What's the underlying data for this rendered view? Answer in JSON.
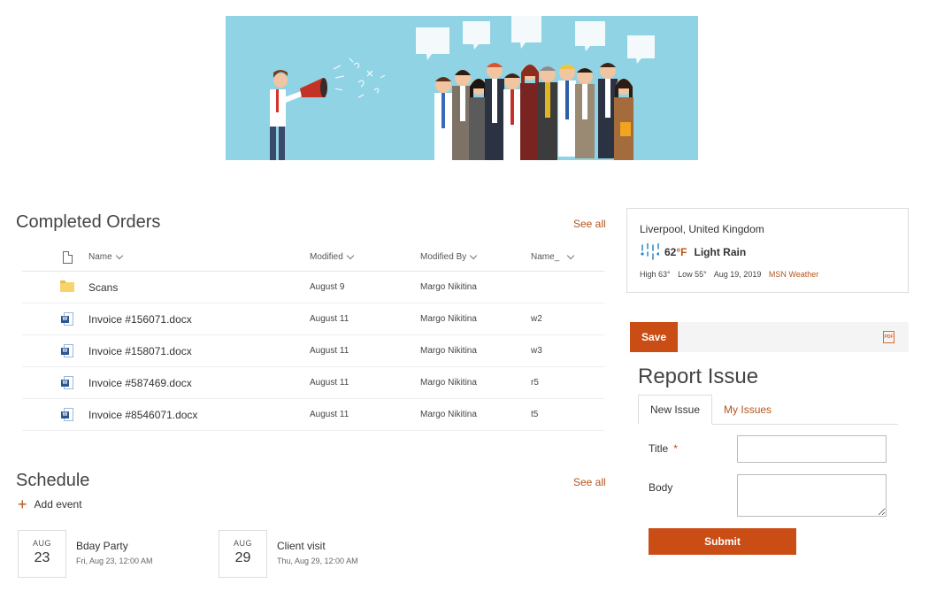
{
  "hero": {
    "alt": "People with speech bubbles and megaphone"
  },
  "orders": {
    "title": "Completed Orders",
    "see_all": "See all",
    "columns": {
      "name": "Name",
      "modified": "Modified",
      "modified_by": "Modified By",
      "name2": "Name_"
    },
    "rows": [
      {
        "icon": "folder-icon",
        "name": "Scans",
        "modified": "August 9",
        "modified_by": "Margo Nikitina",
        "name2": ""
      },
      {
        "icon": "word-document-icon",
        "name": "Invoice #156071.docx",
        "modified": "August 11",
        "modified_by": "Margo Nikitina",
        "name2": "w2"
      },
      {
        "icon": "word-document-icon",
        "name": "Invoice #158071.docx",
        "modified": "August 11",
        "modified_by": "Margo Nikitina",
        "name2": "w3"
      },
      {
        "icon": "word-document-icon",
        "name": "Invoice #587469.docx",
        "modified": "August 11",
        "modified_by": "Margo Nikitina",
        "name2": "r5"
      },
      {
        "icon": "word-document-icon",
        "name": "Invoice #8546071.docx",
        "modified": "August 11",
        "modified_by": "Margo Nikitina",
        "name2": "t5"
      }
    ]
  },
  "schedule": {
    "title": "Schedule",
    "see_all": "See all",
    "add_event": "Add event",
    "events": [
      {
        "month": "AUG",
        "day": "23",
        "title": "Bday Party",
        "datetime": "Fri, Aug 23, 12:00 AM"
      },
      {
        "month": "AUG",
        "day": "29",
        "title": "Client visit",
        "datetime": "Thu, Aug 29, 12:00 AM"
      }
    ]
  },
  "weather": {
    "location": "Liverpool, United Kingdom",
    "icon": "rain-icon",
    "temp": "62",
    "unit": "°F",
    "condition": "Light Rain",
    "high": "High 63°",
    "low": "Low 55°",
    "date": "Aug 19, 2019",
    "source": "MSN Weather"
  },
  "form": {
    "save_label": "Save",
    "pdf_icon_label": "PDF",
    "title": "Report Issue",
    "tabs": [
      {
        "label": "New Issue"
      },
      {
        "label": "My Issues"
      }
    ],
    "fields": {
      "title_label": "Title",
      "required_mark": "*",
      "body_label": "Body",
      "title_value": "",
      "body_value": ""
    },
    "submit_label": "Submit"
  },
  "colors": {
    "accent": "#c94d15",
    "link": "#b5541c",
    "hero_bg": "#8fd3e4"
  }
}
